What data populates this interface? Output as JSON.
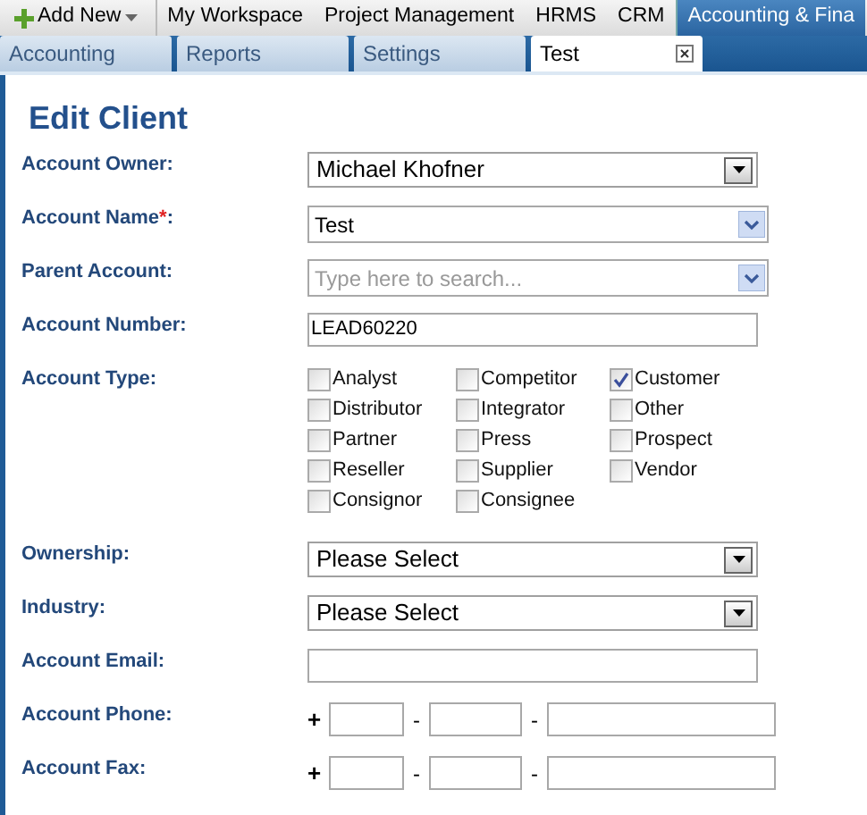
{
  "top_menu": {
    "add_new": "Add New",
    "items": [
      {
        "label": "My Workspace",
        "selected": false
      },
      {
        "label": "Project Management",
        "selected": false
      },
      {
        "label": "HRMS",
        "selected": false
      },
      {
        "label": "CRM",
        "selected": false
      },
      {
        "label": "Accounting & Fina",
        "selected": true
      }
    ]
  },
  "tabs": [
    {
      "label": "Accounting",
      "selected": false,
      "closable": false
    },
    {
      "label": "Reports",
      "selected": false,
      "closable": false
    },
    {
      "label": "Settings",
      "selected": false,
      "closable": false
    },
    {
      "label": "Test",
      "selected": true,
      "closable": true
    }
  ],
  "title": "Edit Client",
  "fields": [
    {
      "kind": "select",
      "label": "Account Owner:",
      "value": "Michael Khofner"
    },
    {
      "kind": "combo",
      "label": "Account Name",
      "required_mark": "*",
      "label_suffix": ":",
      "value": "Test"
    },
    {
      "kind": "combo",
      "label": "Parent Account:",
      "placeholder": "Type here to search..."
    },
    {
      "kind": "text",
      "label": "Account Number:",
      "value": "LEAD60220"
    },
    {
      "kind": "checks",
      "label": "Account Type:",
      "options": [
        {
          "label": "Analyst",
          "checked": false
        },
        {
          "label": "Competitor",
          "checked": false
        },
        {
          "label": "Customer",
          "checked": true
        },
        {
          "label": "Distributor",
          "checked": false
        },
        {
          "label": "Integrator",
          "checked": false
        },
        {
          "label": "Other",
          "checked": false
        },
        {
          "label": "Partner",
          "checked": false
        },
        {
          "label": "Press",
          "checked": false
        },
        {
          "label": "Prospect",
          "checked": false
        },
        {
          "label": "Reseller",
          "checked": false
        },
        {
          "label": "Supplier",
          "checked": false
        },
        {
          "label": "Vendor",
          "checked": false
        },
        {
          "label": "Consignor",
          "checked": false
        },
        {
          "label": "Consignee",
          "checked": false
        }
      ]
    },
    {
      "kind": "select",
      "label": "Ownership:",
      "value": "Please Select"
    },
    {
      "kind": "select",
      "label": "Industry:",
      "value": "Please Select"
    },
    {
      "kind": "text",
      "label": "Account Email:"
    },
    {
      "kind": "phone",
      "label": "Account Phone:",
      "plus": "+",
      "separator": "-"
    },
    {
      "kind": "phone",
      "label": "Account Fax:",
      "plus": "+",
      "separator": "-"
    }
  ]
}
